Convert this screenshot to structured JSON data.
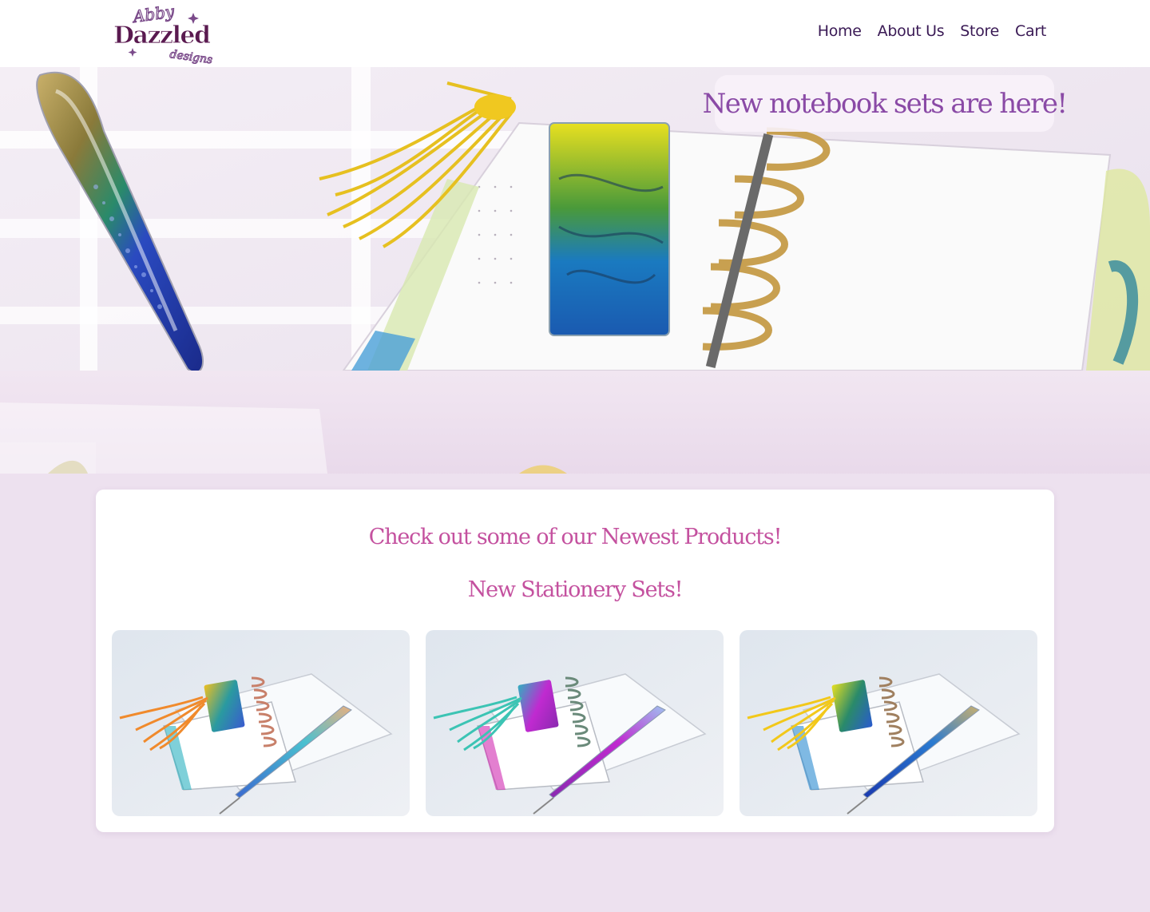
{
  "brand": {
    "logo_alt": "Abby Dazzled designs",
    "logo_top": "Abby",
    "logo_main": "Dazzled",
    "logo_sub": "designs"
  },
  "nav": {
    "items": [
      {
        "label": "Home"
      },
      {
        "label": "About Us"
      },
      {
        "label": "Store"
      },
      {
        "label": "Cart"
      }
    ]
  },
  "hero": {
    "banner_text": "New notebook sets are here!",
    "image_alt": "Resin pen and bookmark on notebook"
  },
  "main": {
    "title": "Check out some of our Newest Products!",
    "subtitle": "New Stationery Sets!",
    "products": [
      {
        "alt": "Stationery set with orange tassel",
        "tassel_color": "#f08a2c",
        "pen_color": "#3a7fd0",
        "accent_color": "#2aa0b0"
      },
      {
        "alt": "Stationery set with teal tassel",
        "tassel_color": "#3cc4b4",
        "pen_color": "#c02ad0",
        "accent_color": "#d02ab0"
      },
      {
        "alt": "Stationery set with yellow tassel",
        "tassel_color": "#f2c81a",
        "pen_color": "#3a5ad0",
        "accent_color": "#2a8ad0"
      }
    ]
  },
  "colors": {
    "page_bg": "#ede1ef",
    "nav_text": "#3a1a55",
    "banner_text": "#8a4aa6",
    "heading_pink": "#c4519f"
  }
}
